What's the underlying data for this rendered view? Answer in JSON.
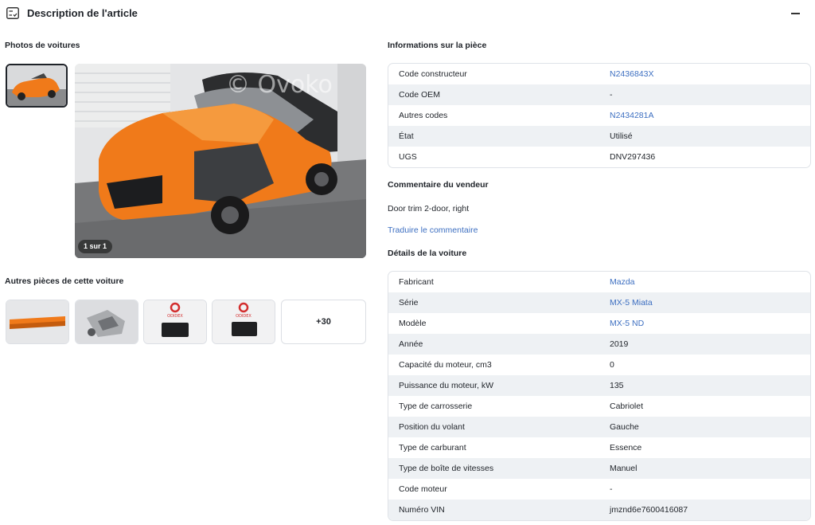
{
  "header": {
    "title": "Description de l'article"
  },
  "photos": {
    "section_title": "Photos de voitures",
    "watermark": "© Ovoko",
    "counter": "1 sur 1"
  },
  "other_parts": {
    "section_title": "Autres pièces de cette voiture",
    "thumb_brand": "ODIDEX",
    "more_label": "+30"
  },
  "part_info": {
    "section_title": "Informations sur la pièce",
    "rows": [
      {
        "key": "Code constructeur",
        "value": "N2436843X"
      },
      {
        "key": "Code OEM",
        "value": "-"
      },
      {
        "key": "Autres codes",
        "value": "N2434281A"
      },
      {
        "key": "État",
        "value": "Utilisé"
      },
      {
        "key": "UGS",
        "value": "DNV297436"
      }
    ]
  },
  "seller_comment": {
    "section_title": "Commentaire du vendeur",
    "text": "Door trim 2-door, right",
    "translate_link": "Traduire le commentaire"
  },
  "car_details": {
    "section_title": "Détails de la voiture",
    "rows": [
      {
        "key": "Fabricant",
        "value": "Mazda"
      },
      {
        "key": "Série",
        "value": "MX-5 Miata"
      },
      {
        "key": "Modèle",
        "value": "MX-5 ND"
      },
      {
        "key": "Année",
        "value": "2019"
      },
      {
        "key": "Capacité du moteur, cm3",
        "value": "0"
      },
      {
        "key": "Puissance du moteur, kW",
        "value": "135"
      },
      {
        "key": "Type de carrosserie",
        "value": "Cabriolet"
      },
      {
        "key": "Position du volant",
        "value": "Gauche"
      },
      {
        "key": "Type de carburant",
        "value": "Essence"
      },
      {
        "key": "Type de boîte de vitesses",
        "value": "Manuel"
      },
      {
        "key": "Code moteur",
        "value": "-"
      },
      {
        "key": "Numéro VIN",
        "value": "jmznd6e7600416087"
      }
    ]
  },
  "colors": {
    "link": "#3d6fc1",
    "row_alt": "#eef1f4",
    "car_orange": "#f07a1a"
  }
}
